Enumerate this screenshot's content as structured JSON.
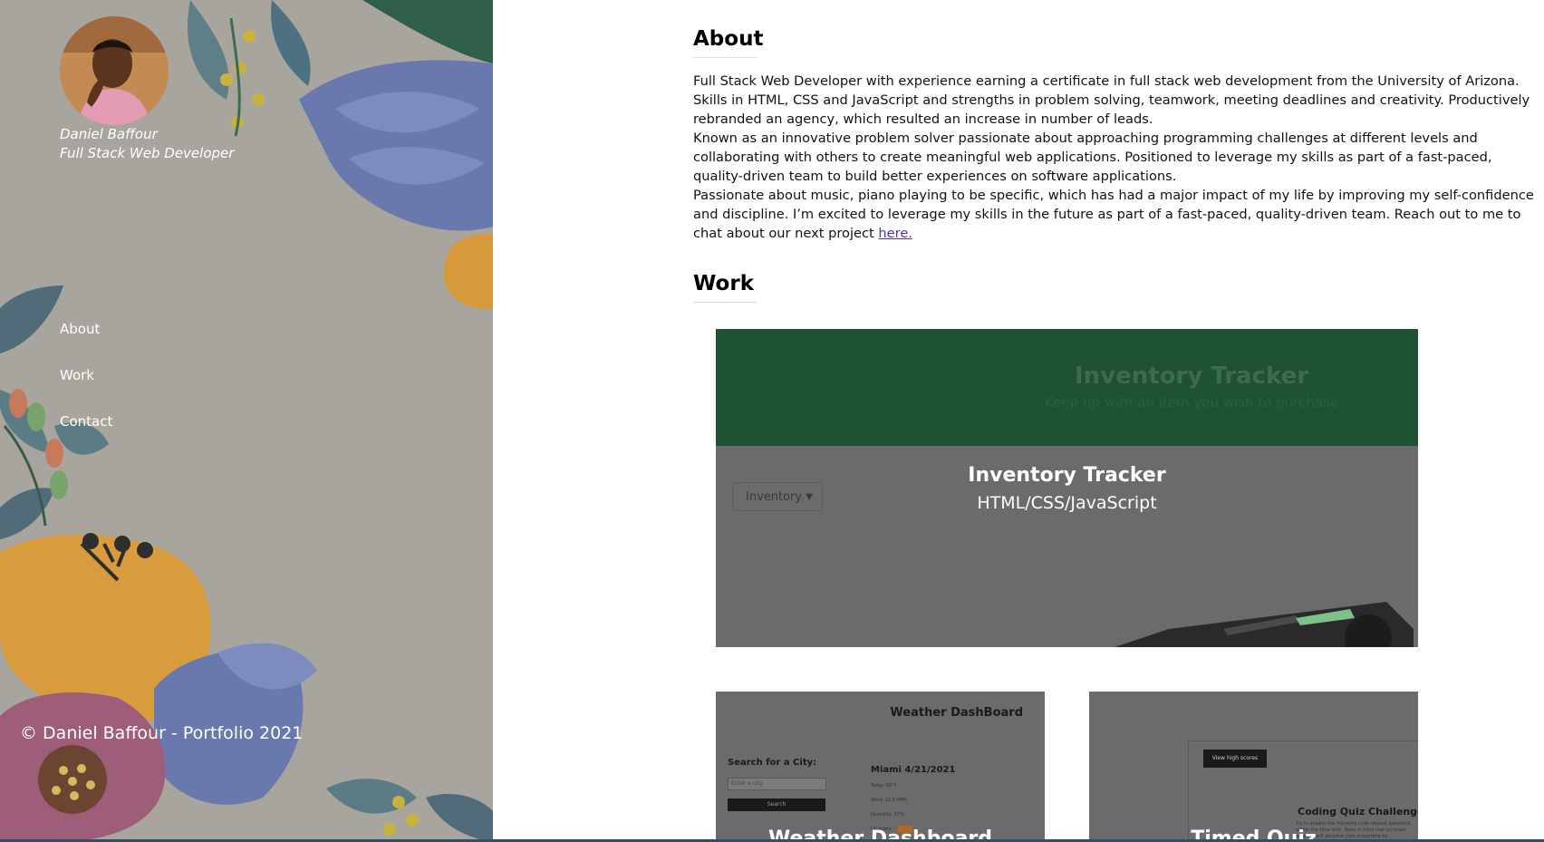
{
  "sidebar": {
    "name": "Daniel Baffour",
    "role": "Full Stack Web Developer",
    "nav": [
      "About",
      "Work",
      "Contact"
    ],
    "footer": "© Daniel Baffour - Portfolio 2021"
  },
  "about": {
    "heading": "About",
    "paragraphs": [
      "Full Stack Web Developer with experience earning a certificate in full stack web development from the University of Arizona. Skills in HTML, CSS and JavaScript and strengths in problem solving, teamwork, meeting deadlines and creativity. Productively rebranded an agency, which resulted an increase in number of leads.",
      "Known as an innovative problem solver passionate about approaching programming challenges at different levels and collaborating with others to create meaningful web applications. Positioned to leverage my skills as part of a fast-paced, quality-driven team to build better experiences on software applications.",
      "Passionate about music, piano playing to be specific, which has had a major impact of my life by improving my self-confidence and discipline. I’m excited to leverage my skills in the future as part of a fast-paced, quality-driven team. Reach out to me to chat about our next project "
    ],
    "link_text": "here."
  },
  "work": {
    "heading": "Work",
    "projects": [
      {
        "title": "Inventory Tracker",
        "tech": "HTML/CSS/JavaScript",
        "preview_title": "Inventory Tracker",
        "preview_subtitle": "Keep up with an item you wish to purchase",
        "preview_select": "Inventory"
      },
      {
        "title": "Weather Dashboard",
        "preview_title": "Weather DashBoard",
        "preview_search_label": "Search for a City:",
        "preview_search_placeholder": "Enter a city",
        "preview_search_button": "Search",
        "preview_city": "Miami 4/21/2021",
        "preview_temp": "Temp: 80°F",
        "preview_wind": "Wind: 11.5 MPH",
        "preview_humidity": "Humidity: 57%",
        "preview_uv": "UV Index:"
      },
      {
        "title": "Timed Quiz",
        "preview_button": "View high scores",
        "preview_title": "Coding Quiz Challenge",
        "preview_text": "Try to answer the following code-related questions within the time limit. Keep in mind that incorrect answers will penalize your score/time by"
      }
    ]
  },
  "colors": {
    "sidebar_bg": "#a8a59e",
    "banner_green": "#1e5232",
    "card_overlay": "#6b6b6b",
    "link": "#5a2ea6"
  }
}
